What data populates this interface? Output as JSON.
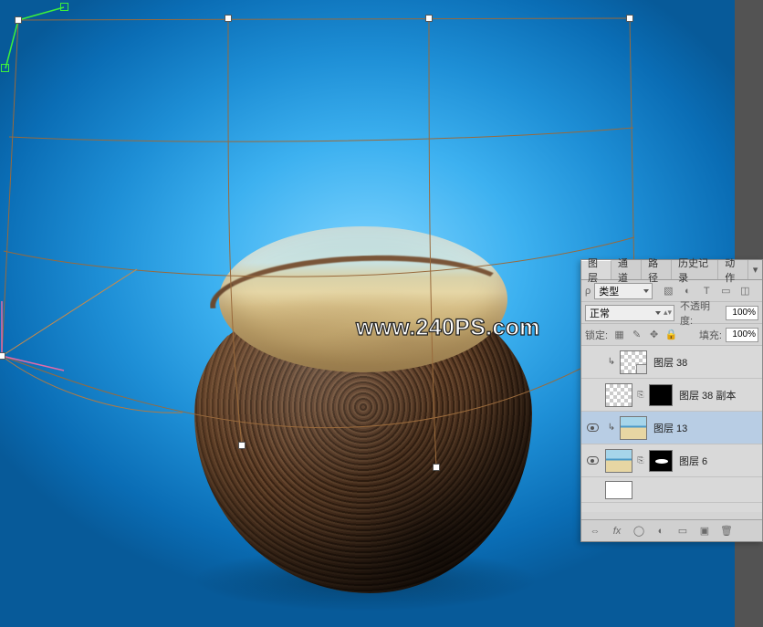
{
  "watermark": "www.240PS.com",
  "panel": {
    "tabs": [
      "图层",
      "通道",
      "路径",
      "历史记录",
      "动作"
    ],
    "active_tab_index": 0,
    "filter_row": {
      "kind_label": "类型",
      "icons": [
        "image-icon",
        "adjustment-icon",
        "type-icon",
        "shape-icon",
        "smartobj-icon"
      ]
    },
    "blend_row": {
      "blend_mode": "正常",
      "opacity_label": "不透明度:",
      "opacity_value": "100%"
    },
    "lock_row": {
      "lock_label": "锁定:",
      "fill_label": "填充:",
      "fill_value": "100%"
    },
    "layers": [
      {
        "visible": false,
        "indent": true,
        "thumb": "checker",
        "fx_badge": true,
        "mask": null,
        "name": "图层 38",
        "selected": false
      },
      {
        "visible": false,
        "indent": false,
        "thumb": "checker",
        "mask": "black",
        "name": "图层 38 副本",
        "selected": false
      },
      {
        "visible": true,
        "indent": true,
        "thumb": "beach",
        "mask": null,
        "name": "图层 13",
        "selected": true
      },
      {
        "visible": true,
        "indent": false,
        "thumb": "beach",
        "mask": "black-dot",
        "name": "图层 6",
        "selected": false
      }
    ],
    "bottom_icons": [
      "link-icon",
      "fx-icon",
      "mask-icon",
      "adjust-icon",
      "group-icon",
      "new-icon",
      "trash-icon"
    ]
  }
}
